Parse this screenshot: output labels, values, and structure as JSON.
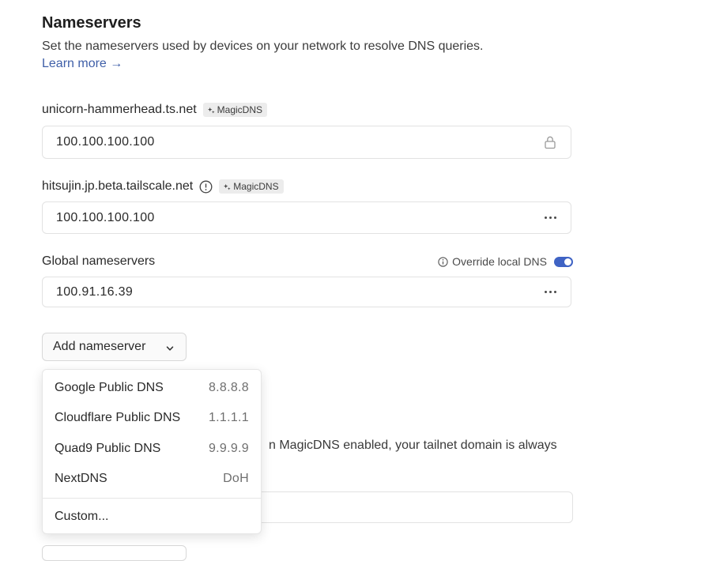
{
  "section": {
    "title": "Nameservers",
    "description": "Set the nameservers used by devices on your network to resolve DNS queries.",
    "learn_more": "Learn more →"
  },
  "nameservers": [
    {
      "domain": "unicorn-hammerhead.ts.net",
      "badge": "MagicDNS",
      "value": "100.100.100.100",
      "action_icon": "lock-icon"
    },
    {
      "domain": "hitsujin.jp.beta.tailscale.net",
      "badge": "MagicDNS",
      "value": "100.100.100.100",
      "action_icon": "more-icon",
      "info_icon": "alert-circle-icon"
    }
  ],
  "global": {
    "label": "Global nameservers",
    "override_label": "Override local DNS",
    "override_enabled": true,
    "value": "100.91.16.39",
    "action_icon": "more-icon"
  },
  "add_button": {
    "label": "Add nameserver"
  },
  "dropdown": {
    "items": [
      {
        "name": "Google Public DNS",
        "value": "8.8.8.8"
      },
      {
        "name": "Cloudflare Public DNS",
        "value": "1.1.1.1"
      },
      {
        "name": "Quad9 Public DNS",
        "value": "9.9.9.9"
      },
      {
        "name": "NextDNS",
        "value": "DoH"
      }
    ],
    "custom": "Custom..."
  },
  "background": {
    "partial_text": "n MagicDNS enabled, your tailnet domain is always"
  },
  "colors": {
    "accent": "#3f63c4",
    "link": "#3f5fa8",
    "border": "#e2e2e2"
  }
}
